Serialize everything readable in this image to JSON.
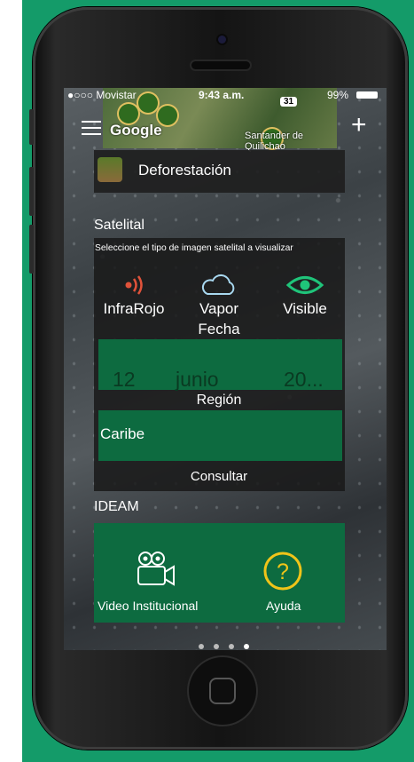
{
  "status_bar": {
    "carrier": "●○○○ Movistar",
    "time": "9:43 a.m.",
    "battery": "99%"
  },
  "header": {
    "brand": "Google",
    "map_route": "31",
    "map_city": "Santander de Quilichao",
    "plus": "+"
  },
  "layer": {
    "label": "Deforestación"
  },
  "satelital": {
    "title": "Satelital",
    "description": "Seleccione el tipo de imagen satelital a visualizar",
    "options": [
      {
        "label": "InfraRojo",
        "icon": "infrared-icon",
        "color": "#e0523a"
      },
      {
        "label": "Vapor",
        "icon": "cloud-icon",
        "color": "#a8d8f0"
      },
      {
        "label": "Visible",
        "icon": "eye-icon",
        "color": "#1fc47a"
      }
    ],
    "date_label": "Fecha",
    "date": {
      "day": "12",
      "month": "junio",
      "year": "20..."
    },
    "region_label": "Región",
    "region_value": "Caribe",
    "submit_label": "Consultar"
  },
  "ideam": {
    "title": "IDEAM",
    "tiles": [
      {
        "label": "Video Institucional",
        "icon": "video-camera-icon"
      },
      {
        "label": "Ayuda",
        "icon": "help-icon",
        "color": "#f0c419"
      }
    ]
  },
  "pager": {
    "count": 4,
    "active": 3
  }
}
